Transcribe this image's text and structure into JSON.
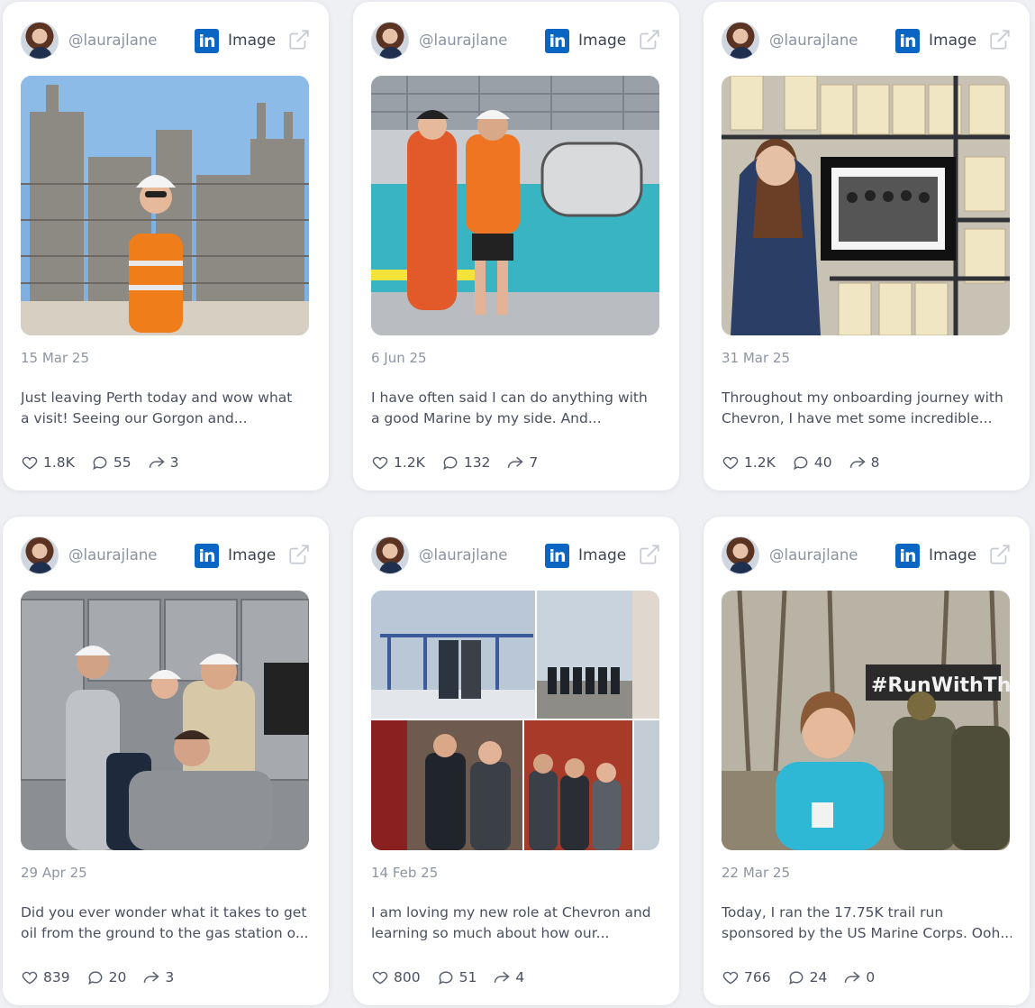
{
  "platform_label": "Image",
  "posts": [
    {
      "handle": "@laurajlane",
      "type": "Image",
      "date": "15 Mar 25",
      "text_line1": "Just leaving Perth today and wow what",
      "text_line2": "a visit! Seeing our Gorgon and...",
      "likes": "1.8K",
      "comments": "55",
      "shares": "3",
      "image_icon": "refinery-photo"
    },
    {
      "handle": "@laurajlane",
      "type": "Image",
      "date": "6 Jun 25",
      "text_line1": "I have often said I can do anything with",
      "text_line2": "a good Marine by my side. And...",
      "likes": "1.2K",
      "comments": "132",
      "shares": "7",
      "image_icon": "pool-training-photo"
    },
    {
      "handle": "@laurajlane",
      "type": "Image",
      "date": "31 Mar 25",
      "text_line1": "Throughout my onboarding journey with",
      "text_line2": "Chevron, I have met some incredible...",
      "likes": "1.2K",
      "comments": "40",
      "shares": "8",
      "image_icon": "archive-photo"
    },
    {
      "handle": "@laurajlane",
      "type": "Image",
      "date": "29 Apr 25",
      "text_line1": "Did you ever wonder what it takes to get",
      "text_line2": "oil from the ground to the gas station o...",
      "likes": "839",
      "comments": "20",
      "shares": "3",
      "image_icon": "control-room-photo"
    },
    {
      "handle": "@laurajlane",
      "type": "Image",
      "date": "14 Feb 25",
      "text_line1": "I am loving my new role at Chevron and",
      "text_line2": "learning so much about how our...",
      "likes": "800",
      "comments": "51",
      "shares": "4",
      "image_icon": "collage-photo"
    },
    {
      "handle": "@laurajlane",
      "type": "Image",
      "date": "22 Mar 25",
      "text_line1": "Today, I ran the 17.75K trail run",
      "text_line2": "sponsored by the US Marine Corps. Ooh...",
      "likes": "766",
      "comments": "24",
      "shares": "0",
      "image_icon": "trail-run-photo",
      "banner_text": "#RunWithThe Marines"
    }
  ],
  "colors": {
    "linkedin": "#0a66c2",
    "muted": "#8d95a3",
    "text": "#4a5060"
  }
}
